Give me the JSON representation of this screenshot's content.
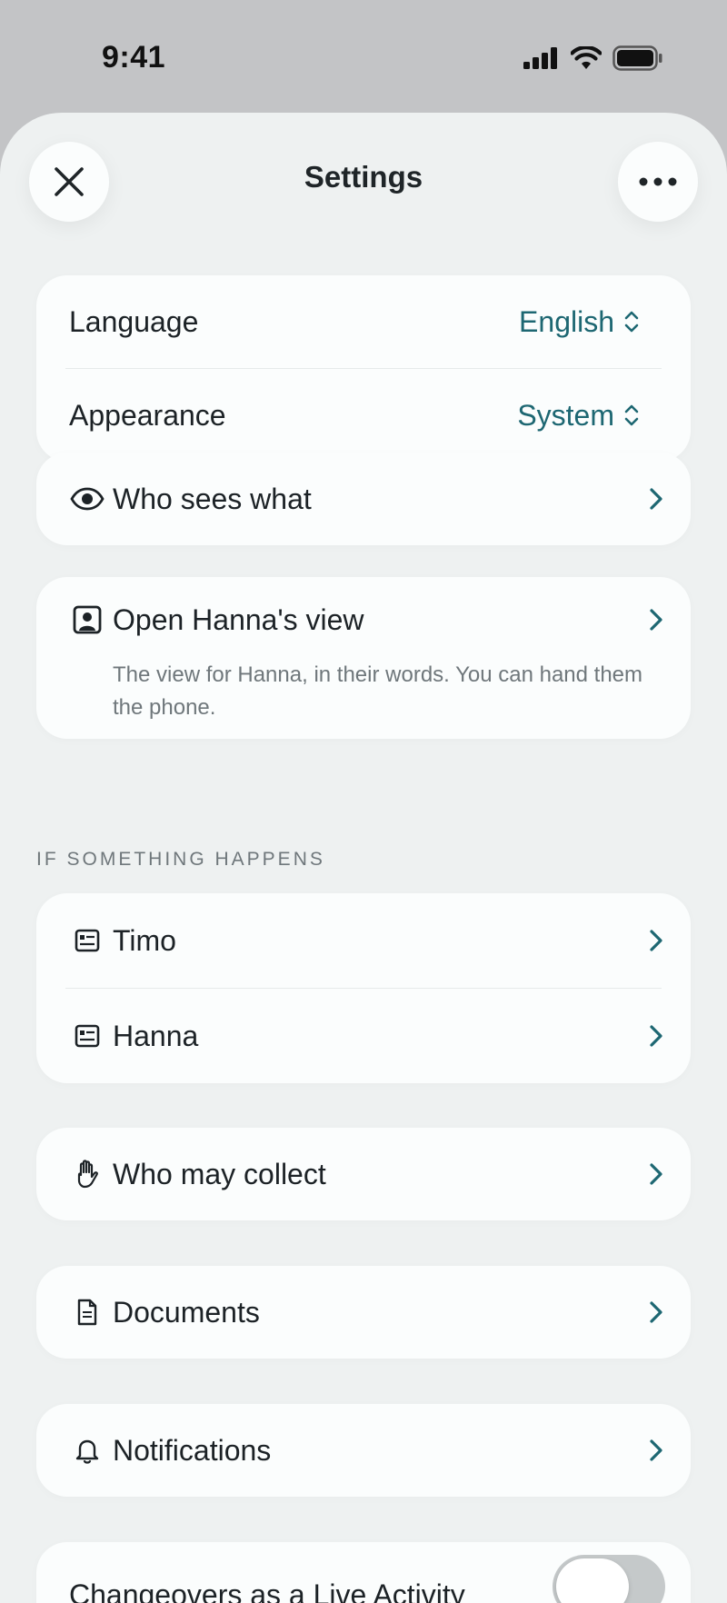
{
  "status": {
    "time": "9:41"
  },
  "header": {
    "title": "Settings"
  },
  "prefs": {
    "language_label": "Language",
    "language_value": "English",
    "appearance_label": "Appearance",
    "appearance_value": "System"
  },
  "who_sees": {
    "label": "Who sees what"
  },
  "hanna_view": {
    "label": "Open Hanna's view",
    "description": "The view for Hanna, in their words. You can hand them the phone."
  },
  "emergency": {
    "section_title": "IF SOMETHING HAPPENS",
    "items": [
      {
        "label": "Timo"
      },
      {
        "label": "Hanna"
      }
    ]
  },
  "collect": {
    "label": "Who may collect"
  },
  "documents": {
    "label": "Documents"
  },
  "notifications": {
    "label": "Notifications"
  },
  "live_activity": {
    "label": "Changeovers as a Live Activity",
    "enabled": false
  },
  "colors": {
    "accent": "#1d6772",
    "background": "#eef1f1",
    "card": "#fbfdfd"
  }
}
